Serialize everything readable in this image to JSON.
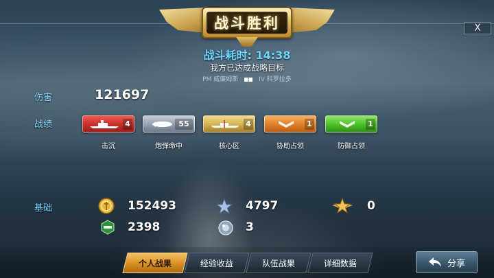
{
  "header": {
    "title": "战斗胜利"
  },
  "close_label": "X",
  "battle": {
    "duration_label": "战斗耗时:",
    "duration_value": "14:38",
    "objective": "我方已达成战略目标",
    "own_ship": "PM 威廉姆斯",
    "enemy_ship": "IV 科罗拉多"
  },
  "damage": {
    "label": "伤害",
    "value": "121697"
  },
  "achievements": {
    "label": "战绩",
    "items": [
      {
        "label": "击沉",
        "count": "4",
        "color": "#c9312a",
        "icon": "warship-icon"
      },
      {
        "label": "炮弹命中",
        "count": "55",
        "color": "#98a3b1",
        "icon": "shell-hit-icon"
      },
      {
        "label": "核心区",
        "count": "4",
        "color": "#d6b255",
        "icon": "citadel-icon"
      },
      {
        "label": "协助占领",
        "count": "1",
        "color": "#e2812b",
        "icon": "chevron-rank-icon"
      },
      {
        "label": "防御占领",
        "count": "1",
        "color": "#4fc32a",
        "icon": "chevron-rank-icon"
      }
    ]
  },
  "base": {
    "label": "基础",
    "silver": "152493",
    "free_xp": "4797",
    "commander_xp": "0",
    "ship_xp": "2398",
    "extra": "3"
  },
  "tabs": [
    {
      "label": "个人战果",
      "active": true
    },
    {
      "label": "经验收益",
      "active": false
    },
    {
      "label": "队伍战果",
      "active": false
    },
    {
      "label": "详细数据",
      "active": false
    }
  ],
  "share_label": "分享",
  "colors": {
    "accent_blue": "#7fd4ff",
    "gold": "#e2bd5f"
  }
}
